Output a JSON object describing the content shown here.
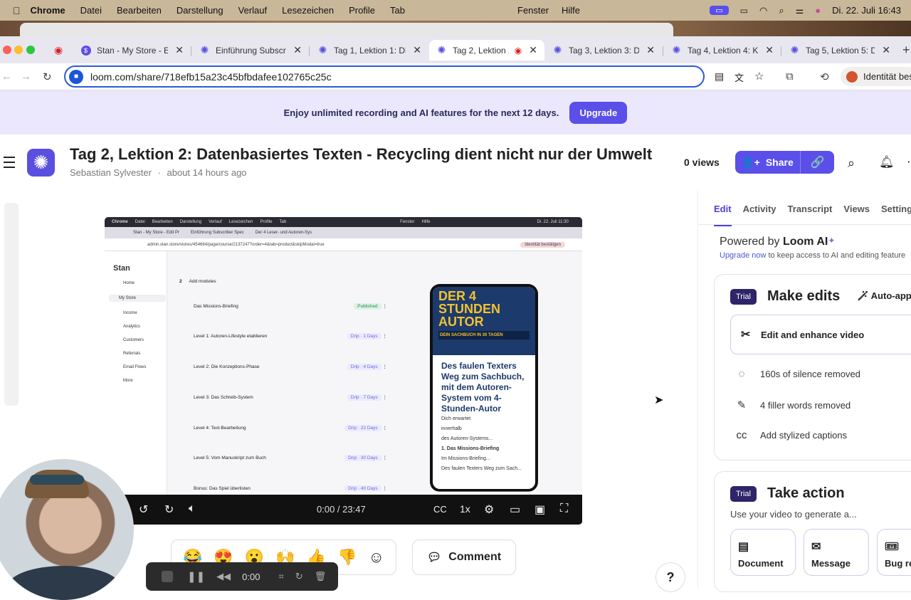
{
  "menubar": {
    "app": "Chrome",
    "items": [
      "Datei",
      "Bearbeiten",
      "Darstellung",
      "Verlauf",
      "Lesezeichen",
      "Profile",
      "Tab"
    ],
    "right_items": [
      "Fenster",
      "Hilfe"
    ],
    "datetime": "Di. 22. Juli  16:43"
  },
  "tabs": [
    {
      "title": "Stan - My Store - Ed",
      "icon": "stan-icon"
    },
    {
      "title": "Einführung Subscrib",
      "icon": "loom-icon"
    },
    {
      "title": "Tag 1, Lektion 1: Die",
      "icon": "loom-icon"
    },
    {
      "title": "Tag 2, Lektion 2:",
      "icon": "loom-icon",
      "active": true
    },
    {
      "title": "Tag 3, Lektion 3: Die",
      "icon": "loom-icon"
    },
    {
      "title": "Tag 4, Lektion 4: Ko",
      "icon": "loom-icon"
    },
    {
      "title": "Tag 5, Lektion 5: Da",
      "icon": "loom-icon"
    }
  ],
  "address": {
    "url": "loom.com/share/718efb15a23c45bfbdafee102765c25c",
    "identity": "Identität bes"
  },
  "promo": {
    "text": "Enjoy unlimited recording and AI features for the next 12 days.",
    "button": "Upgrade"
  },
  "header": {
    "title": "Tag 2, Lektion 2: Datenbasiertes Texten - Recycling dient nicht nur der Umwelt",
    "author": "Sebastian Sylvester",
    "time": "about 14 hours ago",
    "views": "0 views",
    "share": "Share"
  },
  "video": {
    "time": "0:00 / 23:47",
    "speed": "1x",
    "progress": 0,
    "screen": {
      "menubar": [
        "Chrome",
        "Datei",
        "Bearbeiten",
        "Darstellung",
        "Verlauf",
        "Lesezeichen",
        "Profile",
        "Tab",
        "Fenster",
        "Hilfe",
        "Di. 22. Juli 11:30"
      ],
      "tabs": [
        "Stan - My Store - Edit Pr",
        "Einführung Subscriber Spec",
        "Der 4 Leser- und Autoren-Sys"
      ],
      "url": "admin.stan.store/stores/454664/page/course/2137247?order=4&tab=product&skipModal=true",
      "identity": "Identität bestätigen",
      "brand": "Stan",
      "nav": [
        "Home",
        "My Store",
        "Income",
        "Analytics",
        "Customers",
        "Referrals",
        "Email Flows",
        "More"
      ],
      "section": "Add modules",
      "section_num": "2",
      "modules": [
        {
          "name": "Das Missions-Briefing",
          "badge": "Published"
        },
        {
          "name": "Level 1: Autoren-Lifestyle etablieren",
          "badge": "Drip · 1 Days"
        },
        {
          "name": "Level 2: Die Konzeptions-Phase",
          "badge": "Drip · 4 Days"
        },
        {
          "name": "Level 3: Das Schreib-System",
          "badge": "Drip · 7 Days"
        },
        {
          "name": "Level 4: Text-Bearbeitung",
          "badge": "Drip · 22 Days"
        },
        {
          "name": "Level 5: Vom Manuskript zum Buch",
          "badge": "Drip · 30 Days"
        },
        {
          "name": "Bonus: Das Spiel überlisten",
          "badge": "Drip · 40 Days"
        }
      ],
      "phone": {
        "cover": "DER 4 STUNDEN AUTOR",
        "cover_sub": "DEIN SACHBUCH IN 30 TAGEN",
        "headline": "Des faulen Texters Weg zum Sachbuch, mit dem Autoren-System vom 4-Stunden-Autor",
        "lines": [
          "Dich erwartet",
          "innerhalb",
          "des Autoren-Systems..."
        ],
        "item": "1. Das Missions-Briefing",
        "sub_item": "Im Missions-Briefing...",
        "footer": "Des faulen Texters Weg zum Sach..."
      }
    }
  },
  "reactions": [
    "😂",
    "😍",
    "😮",
    "🙌",
    "👍",
    "👎"
  ],
  "comment": "Comment",
  "recorder": {
    "time": "0:00"
  },
  "help": "?",
  "panel": {
    "tabs": [
      "Edit",
      "Activity",
      "Transcript",
      "Views",
      "Settings"
    ],
    "powered_prefix": "Powered by ",
    "powered_brand": "Loom AI",
    "upgrade_link": "Upgrade now",
    "upgrade_text": " to keep access to AI and editing feature",
    "make_edits": {
      "badge": "Trial",
      "title": "Make edits",
      "auto": "Auto-appl",
      "button": "Edit and enhance video",
      "features": [
        "160s of silence removed",
        "4 filler words removed",
        "Add stylized captions"
      ]
    },
    "take_action": {
      "badge": "Trial",
      "title": "Take action",
      "subtitle": "Use your video to generate a...",
      "buttons": [
        "Document",
        "Message",
        "Bug re"
      ]
    }
  }
}
